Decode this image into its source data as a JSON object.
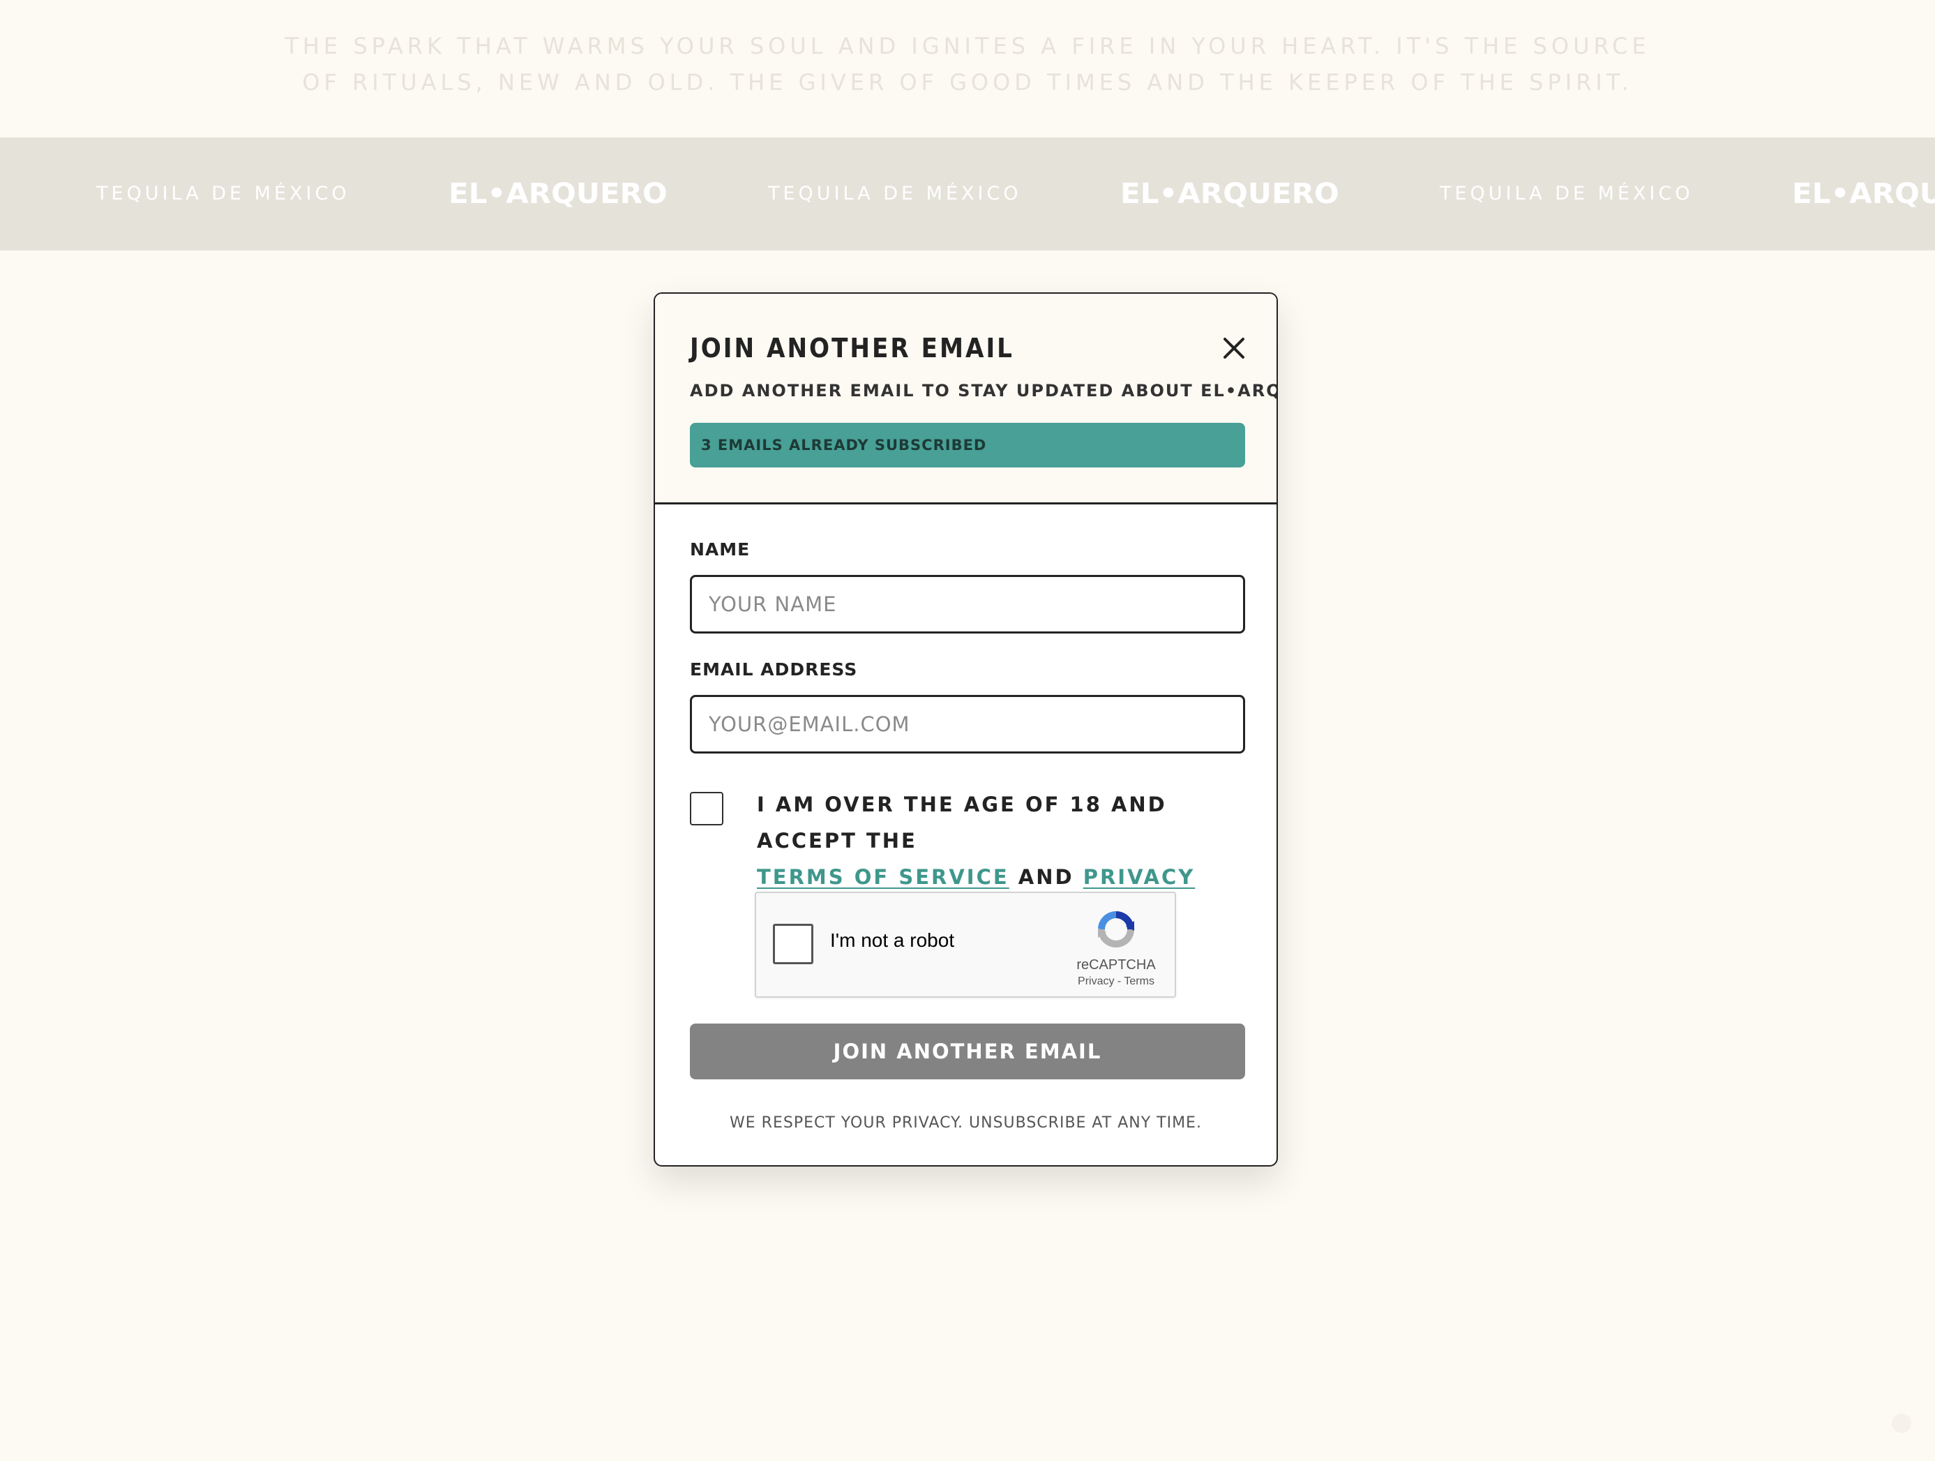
{
  "tagline": {
    "line1": "THE SPARK THAT WARMS YOUR SOUL AND IGNITES A FIRE IN YOUR HEART. IT'S THE SOURCE",
    "line2": "OF RITUALS, NEW AND OLD. THE GIVER OF GOOD TIMES AND THE KEEPER OF THE SPIRIT."
  },
  "band": {
    "items": [
      "TEQUILA DE MÉXICO",
      "EL•ARQUERO",
      "TEQUILA DE MÉXICO",
      "EL•ARQUERO",
      "TEQUILA DE MÉXICO",
      "EL•ARQUERO"
    ]
  },
  "modal": {
    "title": "JOIN ANOTHER EMAIL",
    "close_icon": "close-icon",
    "subtitle": "ADD ANOTHER EMAIL TO STAY UPDATED ABOUT EL•ARQUERO",
    "subscribed_badge": "3 EMAILS ALREADY SUBSCRIBED",
    "name_label": "NAME",
    "name_placeholder": "YOUR NAME",
    "name_value": "",
    "email_label": "EMAIL ADDRESS",
    "email_placeholder": "YOUR@EMAIL.COM",
    "email_value": "",
    "consent": {
      "checked": false,
      "text_before": "I AM OVER THE AGE OF 18 AND ACCEPT THE",
      "terms_link": "TERMS OF SERVICE",
      "connector": "AND",
      "privacy_link": "PRIVACY POLICY"
    },
    "recaptcha": {
      "label": "I'm not a robot",
      "brand": "reCAPTCHA",
      "privacy": "Privacy",
      "separator": "-",
      "terms": "Terms"
    },
    "submit_label": "JOIN ANOTHER EMAIL",
    "privacy_note": "WE RESPECT YOUR PRIVACY. UNSUBSCRIBE AT ANY TIME."
  },
  "colors": {
    "page_background": "#fdfaf3",
    "band_background": "#e5e2da",
    "accent_teal": "#48a096",
    "link_teal": "#3f978c",
    "submit_gray": "#838383",
    "ink": "#232323"
  }
}
